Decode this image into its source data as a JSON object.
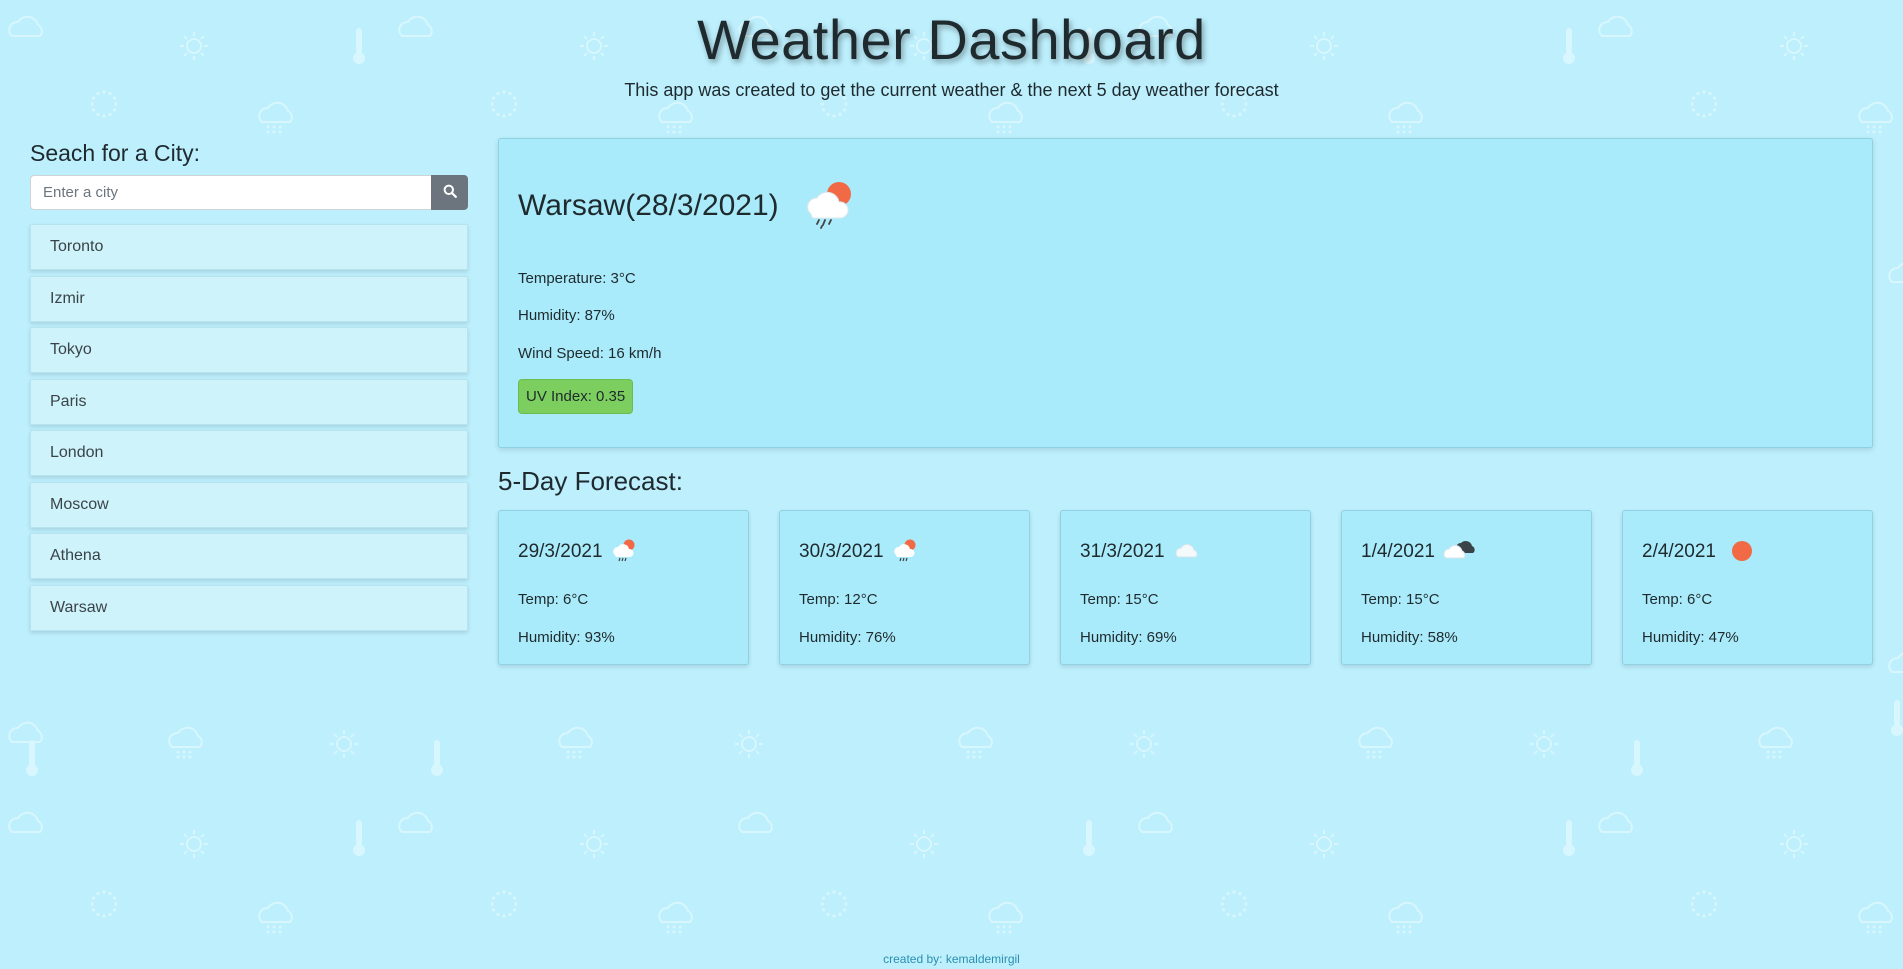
{
  "header": {
    "title": "Weather Dashboard",
    "subtitle": "This app was created to get the current weather & the next 5 day weather forecast"
  },
  "search": {
    "heading": "Seach for a City:",
    "placeholder": "Enter a city",
    "value": "",
    "button_icon": "search-icon"
  },
  "cities": [
    {
      "label": "Toronto"
    },
    {
      "label": "Izmir"
    },
    {
      "label": "Tokyo"
    },
    {
      "label": "Paris"
    },
    {
      "label": "London"
    },
    {
      "label": "Moscow"
    },
    {
      "label": "Athena"
    },
    {
      "label": "Warsaw"
    }
  ],
  "current": {
    "title": "Warsaw(28/3/2021)",
    "icon": "sun-cloud-rain-icon",
    "temperature": "Temperature: 3°C",
    "humidity": "Humidity: 87%",
    "wind": "Wind Speed: 16 km/h",
    "uv": "UV Index: 0.35",
    "uv_color": "#7ccf5f"
  },
  "forecast": {
    "heading": "5-Day Forecast:",
    "days": [
      {
        "date": "29/3/2021",
        "icon": "sun-cloud-rain-icon",
        "temp": "Temp: 6°C",
        "humidity": "Humidity: 93%"
      },
      {
        "date": "30/3/2021",
        "icon": "sun-cloud-rain-icon",
        "temp": "Temp: 12°C",
        "humidity": "Humidity: 76%"
      },
      {
        "date": "31/3/2021",
        "icon": "cloud-icon",
        "temp": "Temp: 15°C",
        "humidity": "Humidity: 69%"
      },
      {
        "date": "1/4/2021",
        "icon": "broken-clouds-icon",
        "temp": "Temp: 15°C",
        "humidity": "Humidity: 58%"
      },
      {
        "date": "2/4/2021",
        "icon": "sun-icon",
        "temp": "Temp: 6°C",
        "humidity": "Humidity: 47%"
      }
    ]
  },
  "footer": {
    "text": "created by: kemaldemirgil"
  },
  "colors": {
    "background": "#bdeffd",
    "card": "#a9ebfa",
    "list_item": "#cef3fb",
    "search_button": "#6c757d",
    "sun": "#f26a45",
    "footer_text": "#2b8fb0"
  }
}
